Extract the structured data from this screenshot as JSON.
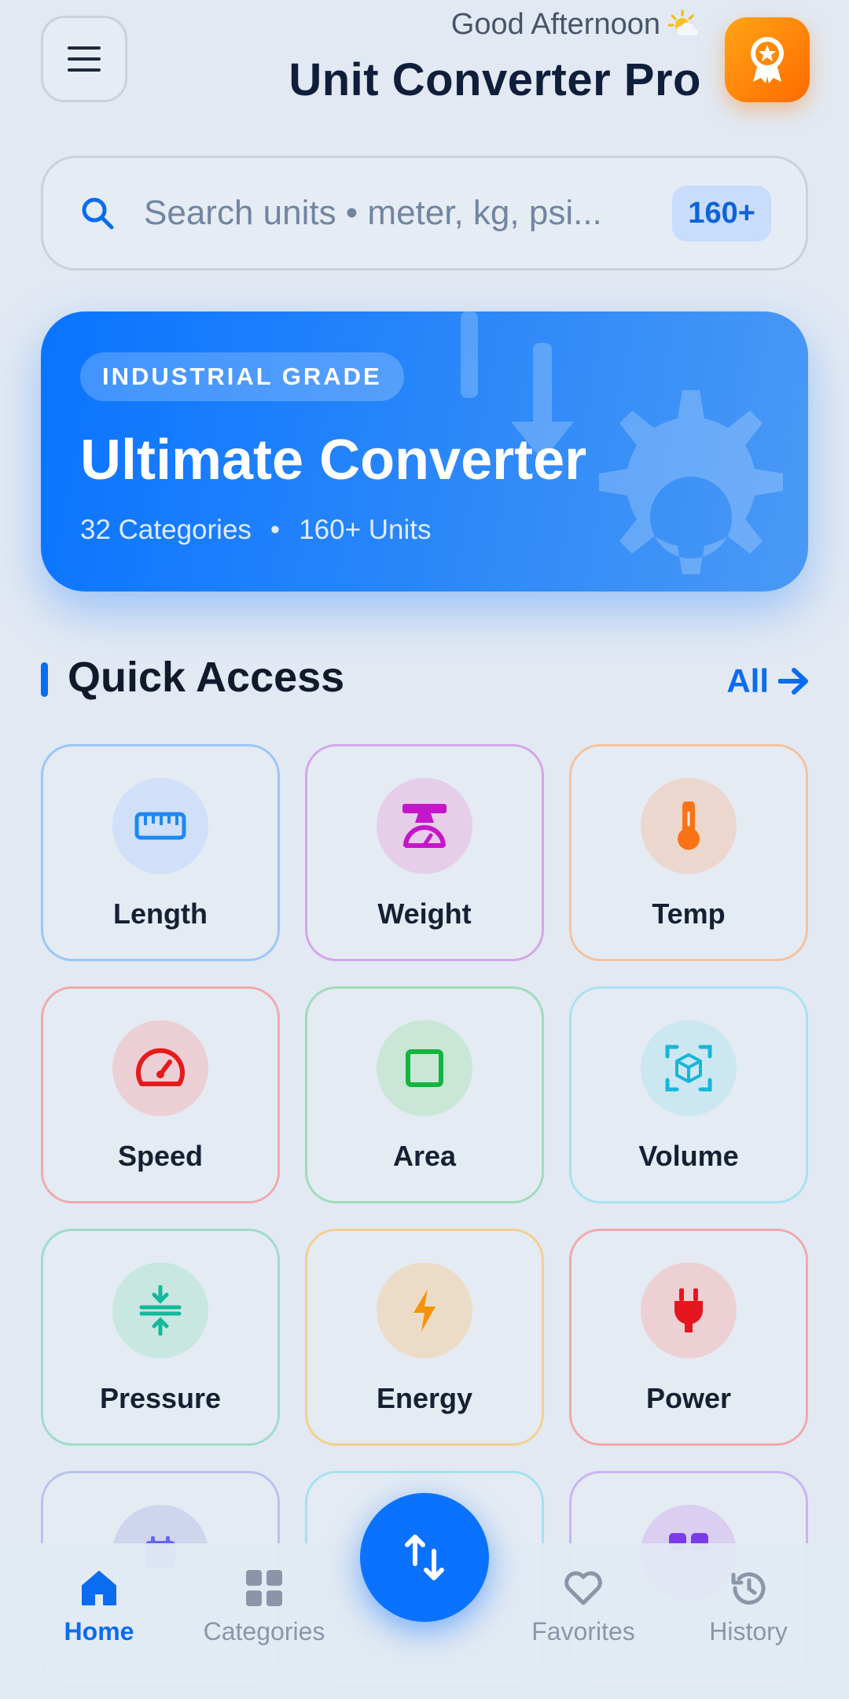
{
  "header": {
    "greeting": "Good Afternoon",
    "greeting_icon": "sun-behind-cloud-icon",
    "title": "Unit Converter Pro"
  },
  "search": {
    "placeholder": "Search units • meter, kg, psi...",
    "count_badge": "160+"
  },
  "hero": {
    "tag": "INDUSTRIAL GRADE",
    "title": "Ultimate Converter",
    "stat_categories": "32 Categories",
    "separator": "•",
    "stat_units": "160+ Units"
  },
  "quick_access": {
    "title": "Quick Access",
    "see_all": "All",
    "items": [
      {
        "label": "Length",
        "icon": "ruler-icon",
        "color": "#1e88f0",
        "bg": "#cfe0f8",
        "border": "#9cc6f5"
      },
      {
        "label": "Weight",
        "icon": "scale-icon",
        "color": "#c516c9",
        "bg": "#e6cdea",
        "border": "#d4a6e8"
      },
      {
        "label": "Temp",
        "icon": "thermometer-icon",
        "color": "#f97316",
        "bg": "#ecd7cf",
        "border": "#f5c39d"
      },
      {
        "label": "Speed",
        "icon": "speedometer-icon",
        "color": "#e51b1b",
        "bg": "#eccfd4",
        "border": "#f1a9ad"
      },
      {
        "label": "Area",
        "icon": "square-icon",
        "color": "#16b33e",
        "bg": "#c9e6d6",
        "border": "#9fdcbb"
      },
      {
        "label": "Volume",
        "icon": "cube-icon",
        "color": "#17b6d8",
        "bg": "#cbe8f2",
        "border": "#a7e2f1"
      },
      {
        "label": "Pressure",
        "icon": "compress-icon",
        "color": "#14b89a",
        "bg": "#c7e7e0",
        "border": "#9fdcca"
      },
      {
        "label": "Energy",
        "icon": "bolt-icon",
        "color": "#f5930a",
        "bg": "#ecdcc7",
        "border": "#f3cf8e"
      },
      {
        "label": "Power",
        "icon": "plug-icon",
        "color": "#e3171d",
        "bg": "#ecd0d3",
        "border": "#f0a9ab"
      }
    ]
  },
  "bottom_nav": {
    "items": [
      {
        "label": "Home",
        "icon": "home-icon",
        "active": true
      },
      {
        "label": "Categories",
        "icon": "grid-icon",
        "active": false
      },
      {
        "label": "Favorites",
        "icon": "heart-icon",
        "active": false
      },
      {
        "label": "History",
        "icon": "history-icon",
        "active": false
      }
    ],
    "fab_icon": "swap-arrows-icon"
  },
  "colors": {
    "accent": "#0a6cf0",
    "award_gradient_start": "#ffa414",
    "award_gradient_end": "#ff6a00"
  }
}
